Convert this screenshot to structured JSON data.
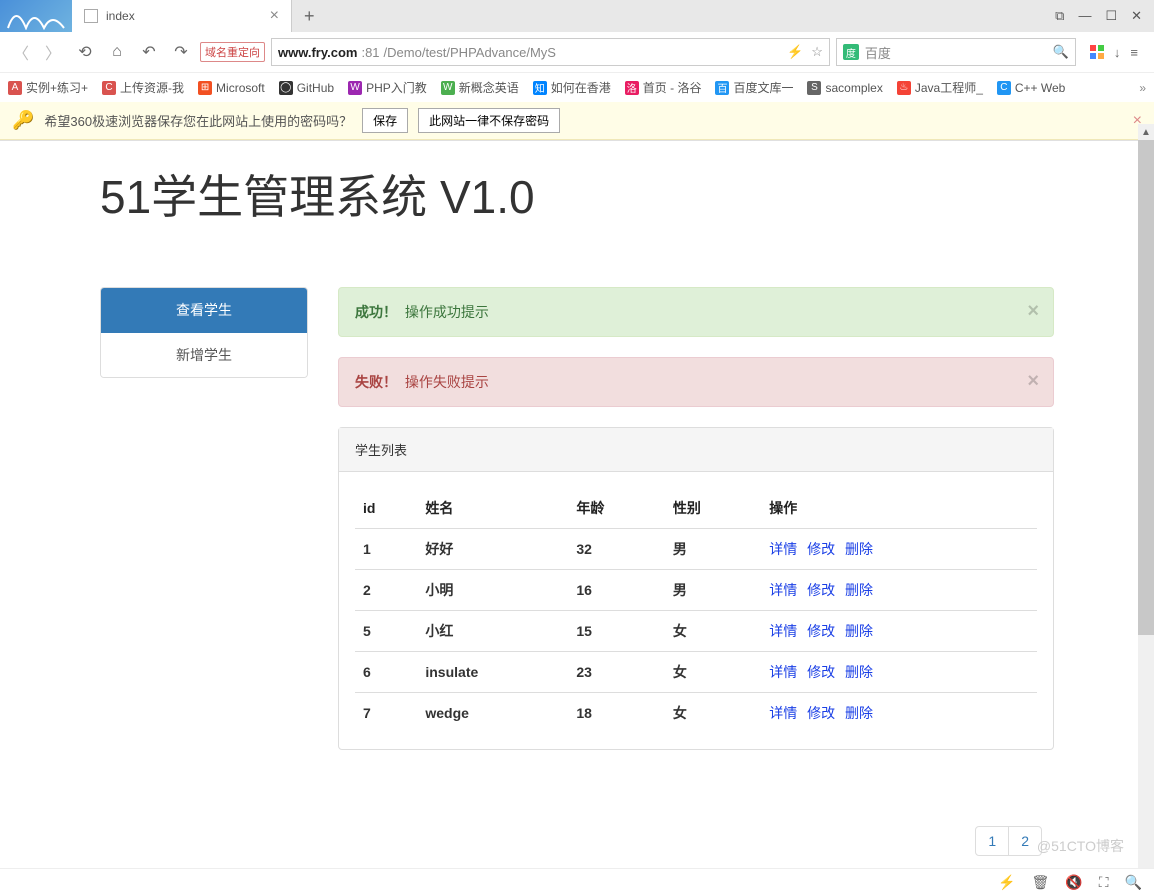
{
  "browser": {
    "tab_title": "index",
    "redirect_label": "域名重定向",
    "url_host": "www.fry.com",
    "url_port": ":81",
    "url_path": "/Demo/test/PHPAdvance/MyS",
    "search_placeholder": "百度",
    "window": {
      "restore": "⧉",
      "minimize": "—",
      "maximize": "☐",
      "close": "✕"
    }
  },
  "bookmarks": [
    {
      "icon": "A",
      "color": "#d9534f",
      "label": "实例+练习+"
    },
    {
      "icon": "C",
      "color": "#d9534f",
      "label": "上传资源-我"
    },
    {
      "icon": "⊞",
      "color": "#f25022",
      "label": "Microsoft"
    },
    {
      "icon": "◯",
      "color": "#333",
      "label": "GitHub"
    },
    {
      "icon": "W",
      "color": "#9c27b0",
      "label": "PHP入门教"
    },
    {
      "icon": "W",
      "color": "#4caf50",
      "label": "新概念英语"
    },
    {
      "icon": "知",
      "color": "#0084ff",
      "label": "如何在香港"
    },
    {
      "icon": "洛",
      "color": "#e91e63",
      "label": "首页 - 洛谷"
    },
    {
      "icon": "百",
      "color": "#2196f3",
      "label": "百度文库一"
    },
    {
      "icon": "S",
      "color": "#666",
      "label": "sacomplex"
    },
    {
      "icon": "♨",
      "color": "#f44336",
      "label": "Java工程师_"
    },
    {
      "icon": "C",
      "color": "#2196f3",
      "label": "C++ Web"
    }
  ],
  "password_bar": {
    "message": "希望360极速浏览器保存您在此网站上使用的密码吗？",
    "save": "保存",
    "never": "此网站一律不保存密码"
  },
  "page": {
    "title": "51学生管理系统 V1.0",
    "sidebar": [
      {
        "label": "查看学生",
        "active": true
      },
      {
        "label": "新增学生",
        "active": false
      }
    ],
    "alert_success": {
      "strong": "成功！",
      "text": "操作成功提示"
    },
    "alert_danger": {
      "strong": "失败！",
      "text": "操作失败提示"
    },
    "panel_title": "学生列表",
    "table": {
      "headers": [
        "id",
        "姓名",
        "年龄",
        "性别",
        "操作"
      ],
      "rows": [
        {
          "id": "1",
          "name": "好好",
          "age": "32",
          "gender": "男"
        },
        {
          "id": "2",
          "name": "小明",
          "age": "16",
          "gender": "男"
        },
        {
          "id": "5",
          "name": "小红",
          "age": "15",
          "gender": "女"
        },
        {
          "id": "6",
          "name": "insulate",
          "age": "23",
          "gender": "女"
        },
        {
          "id": "7",
          "name": "wedge",
          "age": "18",
          "gender": "女"
        }
      ],
      "actions": {
        "detail": "详情",
        "edit": "修改",
        "delete": "删除"
      }
    },
    "pagination": [
      "1",
      "2"
    ],
    "watermark": "@51CTO博客"
  }
}
